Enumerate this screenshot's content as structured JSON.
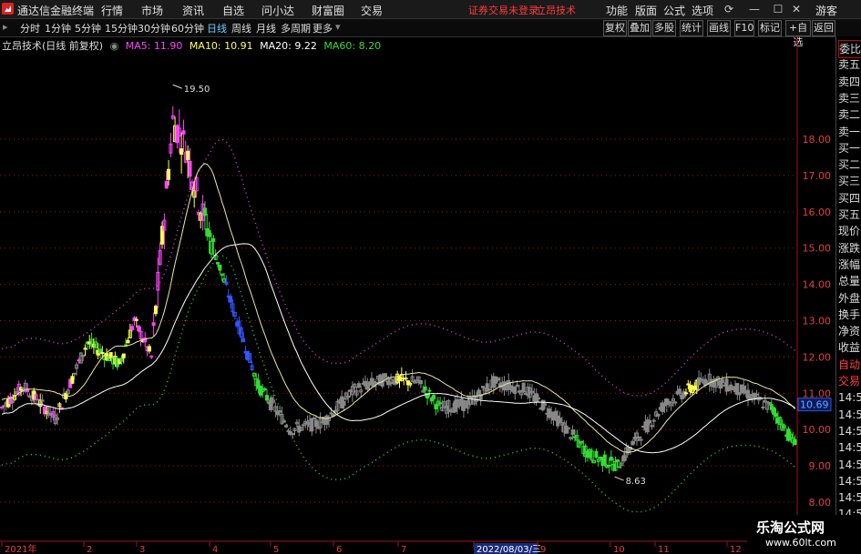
{
  "app": {
    "title": "通达信金融终端"
  },
  "menu": {
    "items": [
      "行情",
      "市场",
      "资讯",
      "自选",
      "问小达",
      "财富圈",
      "交易"
    ],
    "notice": "证券交易未登录",
    "indicator": "立昂技术",
    "right_items": [
      "功能",
      "版面",
      "公式",
      "选项"
    ],
    "guest": "游客"
  },
  "periods": [
    "分时",
    "1分钟",
    "5分钟",
    "15分钟",
    "30分钟",
    "60分钟",
    "日线",
    "周线",
    "月线",
    "多周期",
    "更多"
  ],
  "active_period": "日线",
  "toolbar_right": [
    "复权",
    "叠加",
    "多股",
    "统计",
    "画线",
    "F10",
    "标记",
    "+自选",
    "返回"
  ],
  "legend": {
    "title": "立昂技术(日线 前复权)",
    "ma5": "MA5: 11.90",
    "ma10": "MA10: 10.91",
    "ma20": "MA20: 9.22",
    "ma60": "MA60: 8.20"
  },
  "colors": {
    "ma5": "#ff44ff",
    "ma10": "#ffff55",
    "ma20": "#ffffff",
    "ma60": "#33dd33",
    "up": "#ff3030",
    "grid": "#aa1010"
  },
  "price_axis": {
    "labels": [
      "18.00",
      "17.00",
      "16.00",
      "15.00",
      "14.00",
      "13.00",
      "12.00",
      "11.00",
      "10.00",
      "9.00",
      "8.00"
    ],
    "current": "10.69"
  },
  "annotations": {
    "high": "19.50",
    "low": "8.63"
  },
  "time_axis": {
    "labels": [
      "2021年",
      "2",
      "3",
      "4",
      "5",
      "6",
      "7",
      "8",
      "2022/08/03/三",
      "9",
      "10",
      "11",
      "12"
    ]
  },
  "right_panel": {
    "items": [
      "委比",
      "卖五",
      "卖四",
      "卖三",
      "卖二",
      "卖一",
      "买一",
      "买二",
      "买三",
      "买四",
      "买五",
      "现价",
      "涨跌",
      "涨幅",
      "总量",
      "外盘",
      "换手",
      "净资",
      "收益",
      "自动",
      "交易",
      "14:56",
      "14:56",
      "14:56",
      "14:56",
      "14:56",
      "14:56",
      "14:56",
      "14:56"
    ]
  },
  "watermark": {
    "name": "乐淘公式网",
    "url": "www.60lt.com"
  }
}
